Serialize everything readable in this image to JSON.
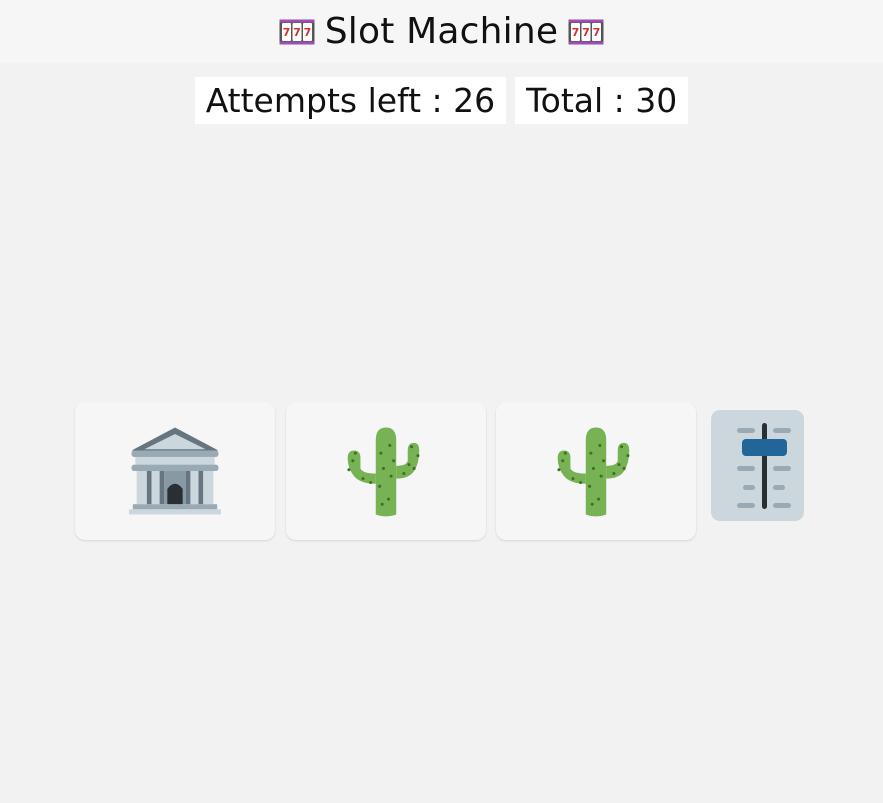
{
  "header": {
    "title": "Slot Machine",
    "left_icon": "slot-machine-icon",
    "right_icon": "slot-machine-icon"
  },
  "stats": {
    "attempts_left_label": "Attempts left : 26",
    "total_label": "Total : 30"
  },
  "reels": [
    {
      "symbol": "classical-building-icon"
    },
    {
      "symbol": "cactus-icon"
    },
    {
      "symbol": "cactus-icon"
    }
  ],
  "lever": {
    "icon": "level-slider-icon"
  },
  "colors": {
    "page_background": "#f2f2f2",
    "header_background": "#f6f6f6",
    "stat_background": "#ffffff",
    "reel_background": "#f6f6f6",
    "lever_background": "#ccd6dd",
    "cactus_green": "#77b255",
    "slider_knob": "#226699"
  }
}
